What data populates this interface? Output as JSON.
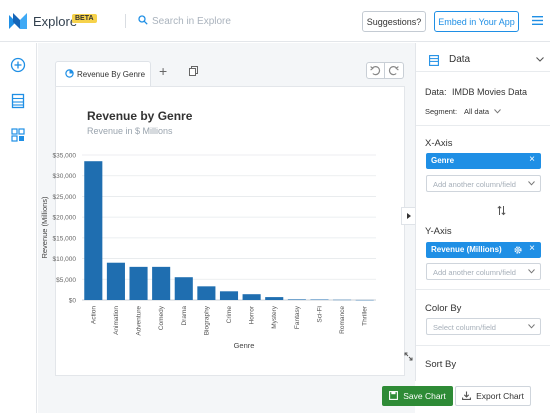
{
  "app": {
    "name": "Explore",
    "badge": "BETA"
  },
  "search": {
    "placeholder": "Search in Explore"
  },
  "header": {
    "suggestions_label": "Suggestions?",
    "embed_label": "Embed in Your App"
  },
  "tabs": [
    {
      "label": "Revenue By Genre"
    }
  ],
  "chart_data": {
    "type": "bar",
    "title": "Revenue by Genre",
    "subtitle": "Revenue in $ Millions",
    "xlabel": "Genre",
    "ylabel": "Revenue (Millions)",
    "categories": [
      "Action",
      "Animation",
      "Adventure",
      "Comedy",
      "Drama",
      "Biography",
      "Crime",
      "Horror",
      "Mystery",
      "Fantasy",
      "Sci-Fi",
      "Romance",
      "Thriller"
    ],
    "values": [
      33500,
      9000,
      8000,
      8000,
      5500,
      3300,
      2100,
      1400,
      700,
      150,
      120,
      60,
      20
    ],
    "ylim": [
      0,
      35000
    ],
    "yticks": [
      "$0",
      "$5,000",
      "$10,000",
      "$15,000",
      "$20,000",
      "$25,000",
      "$30,000",
      "$35,000"
    ],
    "grid": true,
    "bar_color": "#1f6eb0"
  },
  "panel": {
    "section_label": "Data",
    "data_prefix": "Data:",
    "data_value": "IMDB Movies Data",
    "segment_prefix": "Segment:",
    "segment_value": "All data",
    "xaxis_label": "X-Axis",
    "xaxis_chip": "Genre",
    "add_column_placeholder": "Add another column/field",
    "yaxis_label": "Y-Axis",
    "yaxis_chip": "Revenue (Millions)",
    "colorby_label": "Color By",
    "colorby_placeholder": "Select column/field",
    "sortby_label": "Sort By"
  },
  "footer": {
    "save_label": "Save Chart",
    "export_label": "Export Chart"
  },
  "colors": {
    "accent": "#1f8fe5",
    "save": "#2e8b36",
    "bar": "#1f6eb0",
    "badge": "#f6d24b"
  }
}
